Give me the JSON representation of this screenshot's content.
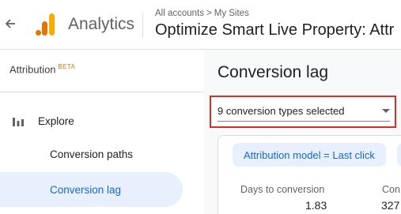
{
  "header": {
    "back_icon": "arrow-left-icon",
    "app_title": "Analytics",
    "breadcrumb": [
      "All accounts",
      "My Sites"
    ],
    "breadcrumb_separator": ">",
    "property_name": "Optimize Smart Live Property: Attr"
  },
  "sidebar": {
    "section_label": "Attribution",
    "section_badge": "BETA",
    "explore_label": "Explore",
    "items": [
      {
        "label": "Conversion paths",
        "active": false
      },
      {
        "label": "Conversion lag",
        "active": true
      }
    ]
  },
  "main": {
    "title": "Conversion lag",
    "select": {
      "value": "9 conversion types selected"
    },
    "chip_label": "Attribution model = Last click",
    "metrics": [
      {
        "label": "Days to conversion",
        "value": "1.83"
      },
      {
        "label": "Con",
        "value": "327"
      }
    ]
  },
  "colors": {
    "accent": "#1967d2",
    "accent_bg": "#e8f0fe",
    "highlight_border": "#d93025",
    "logo_orange": "#f9ab00",
    "logo_dark_orange": "#e37400"
  }
}
